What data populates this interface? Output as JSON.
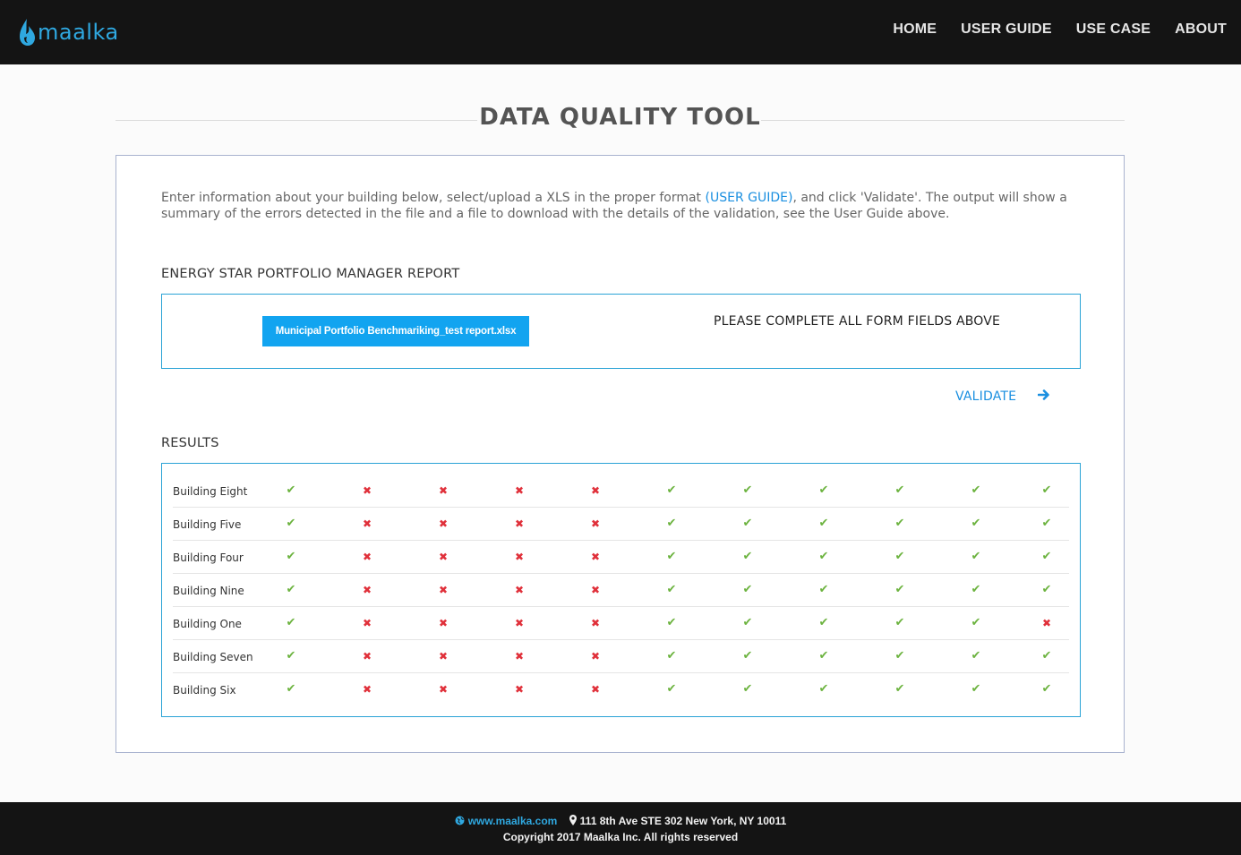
{
  "header": {
    "logo_text": "maalka",
    "nav": [
      "HOME",
      "USER GUIDE",
      "USE CASE",
      "ABOUT"
    ]
  },
  "page": {
    "title": "DATA QUALITY TOOL"
  },
  "intro": {
    "text_before": "Enter information about your building below, select/upload a XLS in the proper format ",
    "link": "(USER GUIDE)",
    "text_after": ", and click 'Validate'. The output will show a summary of the errors detected in the file and a file to download with the details of the validation, see the User Guide above."
  },
  "report": {
    "label": "ENERGY STAR PORTFOLIO MANAGER REPORT",
    "file_button": "Municipal Portfolio Benchmariking_test report.xlsx",
    "message": "PLEASE COMPLETE ALL FORM FIELDS ABOVE"
  },
  "validate": {
    "label": "VALIDATE",
    "icon": "arrow-right-icon"
  },
  "results": {
    "label": "RESULTS",
    "rows": [
      {
        "name": "Building Eight",
        "checks": [
          true,
          false,
          false,
          false,
          false,
          true,
          true,
          true,
          true,
          true,
          true
        ]
      },
      {
        "name": "Building Five",
        "checks": [
          true,
          false,
          false,
          false,
          false,
          true,
          true,
          true,
          true,
          true,
          true
        ]
      },
      {
        "name": "Building Four",
        "checks": [
          true,
          false,
          false,
          false,
          false,
          true,
          true,
          true,
          true,
          true,
          true
        ]
      },
      {
        "name": "Building Nine",
        "checks": [
          true,
          false,
          false,
          false,
          false,
          true,
          true,
          true,
          true,
          true,
          true
        ]
      },
      {
        "name": "Building One",
        "checks": [
          true,
          false,
          false,
          false,
          false,
          true,
          true,
          true,
          true,
          true,
          false
        ]
      },
      {
        "name": "Building Seven",
        "checks": [
          true,
          false,
          false,
          false,
          false,
          true,
          true,
          true,
          true,
          true,
          true
        ]
      },
      {
        "name": "Building Six",
        "checks": [
          true,
          false,
          false,
          false,
          false,
          true,
          true,
          true,
          true,
          true,
          true
        ]
      }
    ]
  },
  "footer": {
    "site": "www.maalka.com",
    "address": "111 8th Ave STE 302 New York, NY 10011",
    "copyright": "Copyright 2017 Maalka Inc. All rights reserved"
  },
  "colors": {
    "accent": "#12a4f0",
    "ok": "#6cb33f",
    "error": "#e0303a",
    "header_bg": "#141414"
  }
}
